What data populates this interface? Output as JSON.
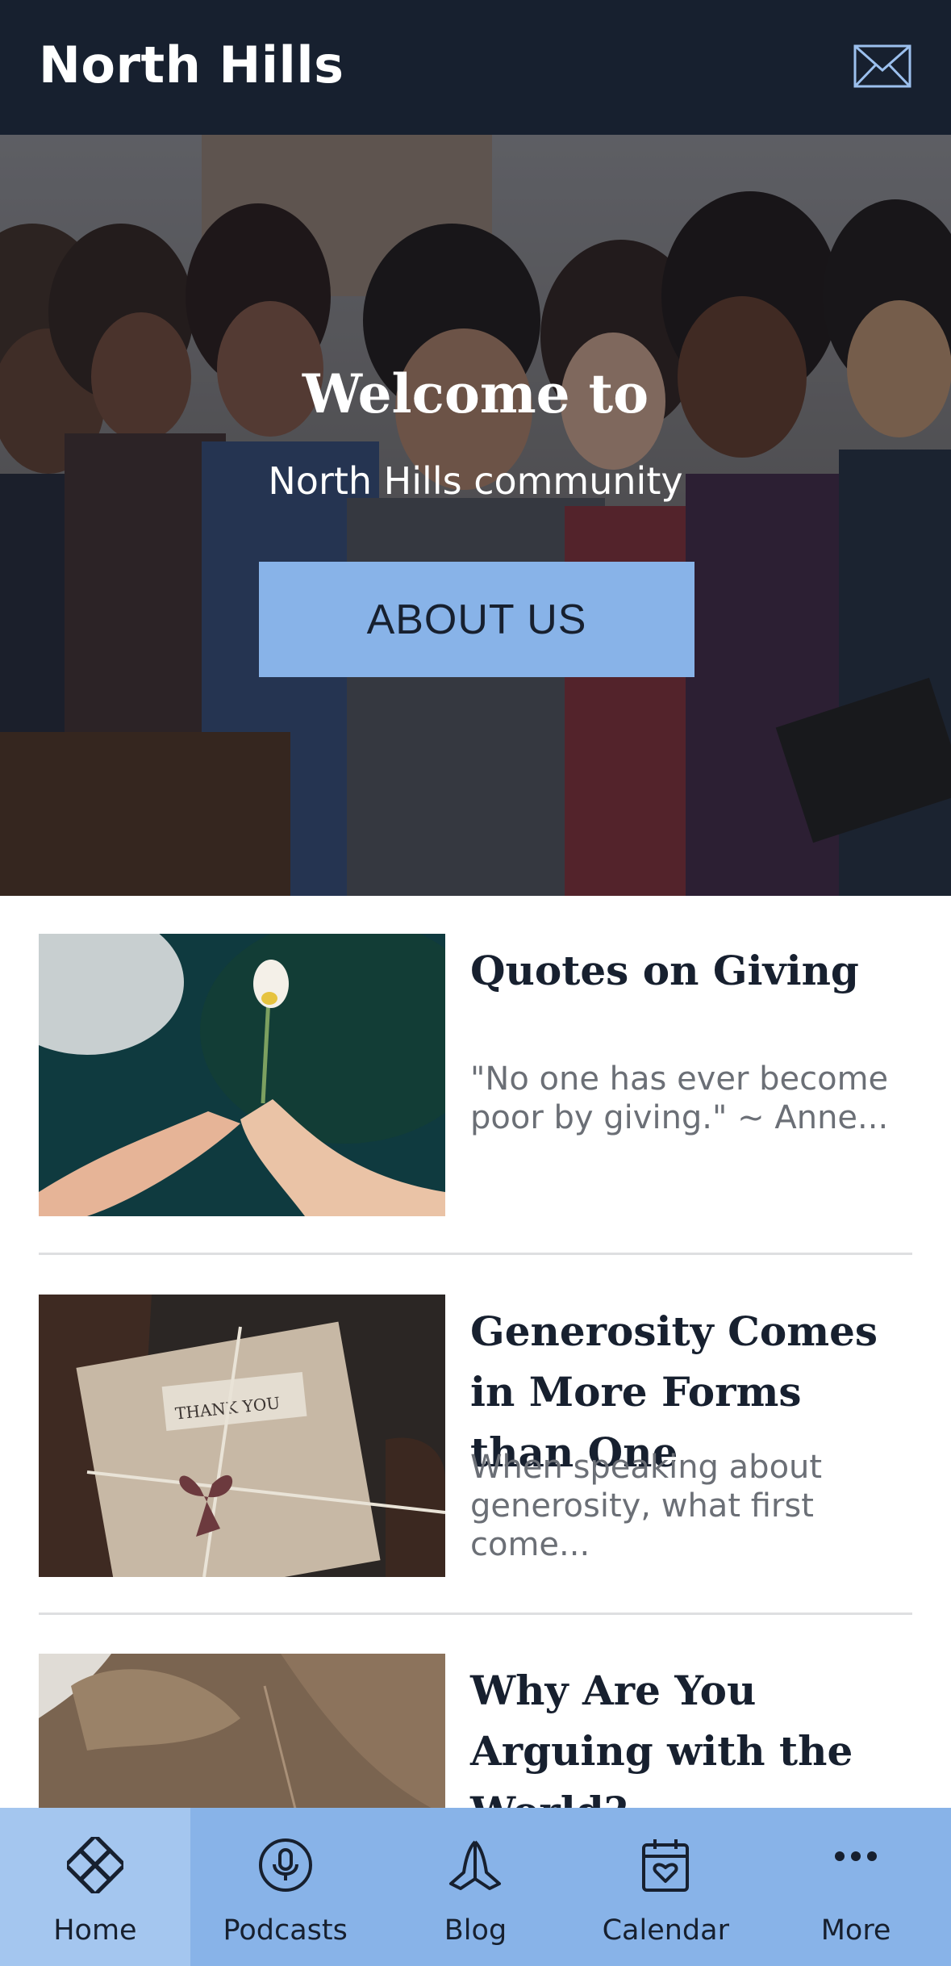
{
  "header": {
    "title": "North Hills",
    "mail_icon": "envelope-icon"
  },
  "hero": {
    "heading": "Welcome to",
    "subheading": "North Hills community",
    "button_label": "ABOUT US",
    "button_color": "#88b3e8"
  },
  "articles": [
    {
      "title": "Quotes on Giving",
      "excerpt": "\"No one has ever become poor by giving.\" ~ Anne...",
      "image": "hands-giving-flower"
    },
    {
      "title": "Generosity Comes in More Forms than One",
      "excerpt": "When speaking about generosity, what first come...",
      "image": "thank-you-gift-package"
    },
    {
      "title": "Why Are You Arguing with the World?",
      "excerpt": "",
      "image": "animal-fur-closeup"
    }
  ],
  "bottom_nav": {
    "items": [
      {
        "label": "Home",
        "icon": "home-knot-icon",
        "active": true
      },
      {
        "label": "Podcasts",
        "icon": "microphone-icon",
        "active": false
      },
      {
        "label": "Blog",
        "icon": "praying-hands-icon",
        "active": false
      },
      {
        "label": "Calendar",
        "icon": "calendar-heart-icon",
        "active": false
      },
      {
        "label": "More",
        "icon": "more-dots-icon",
        "active": false
      }
    ]
  },
  "colors": {
    "header_bg": "#17202f",
    "nav_bg": "#88b3e8",
    "nav_active_bg": "#a4c6ef",
    "title_text": "#17202f",
    "excerpt_text": "#6b6f76"
  }
}
